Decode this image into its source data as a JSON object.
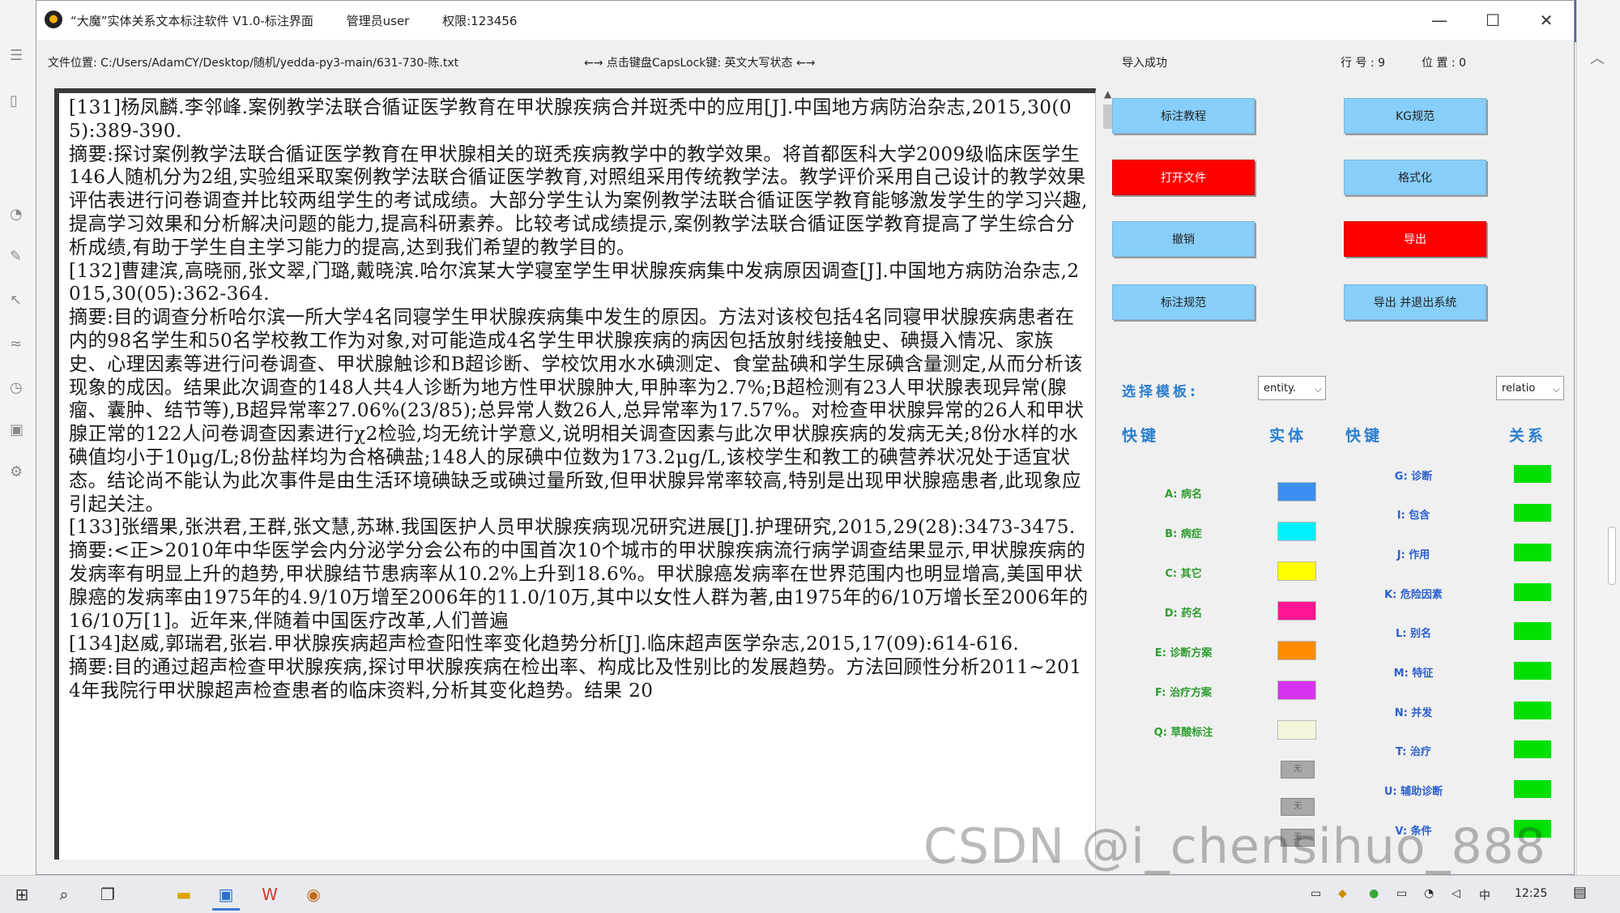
{
  "window": {
    "title": "“大魔”实体关系文本标注软件 V1.0-标注界面",
    "admin": "管理员user",
    "permission": "权限:123456",
    "controls": {
      "minimize": "—",
      "maximize": "☐",
      "close": "✕"
    }
  },
  "infobar": {
    "file_position": "文件位置:  C:/Users/AdamCY/Desktop/随机/yedda-py3-main/631-730-陈.txt",
    "capslock_hint": "←→ 点击键盘CapsLock键:  英文大写状态  ←→",
    "import_status": "导入成功",
    "row": "行 号 : 9",
    "column": "位 置 : 0"
  },
  "editor": {
    "text": "[131]杨凤麟.李邻峰.案例教学法联合循证医学教育在甲状腺疾病合并斑秃中的应用[J].中国地方病防治杂志,2015,30(05):389-390.\n摘要:探讨案例教学法联合循证医学教育在甲状腺相关的斑秃疾病教学中的教学效果。将首都医科大学2009级临床医学生146人随机分为2组,实验组采取案例教学法联合循证医学教育,对照组采用传统教学法。教学评价采用自己设计的教学效果评估表进行问卷调查并比较两组学生的考试成绩。大部分学生认为案例教学法联合循证医学教育能够激发学生的学习兴趣,提高学习效果和分析解决问题的能力,提高科研素养。比较考试成绩提示,案例教学法联合循证医学教育提高了学生综合分析成绩,有助于学生自主学习能力的提高,达到我们希望的教学目的。\n[132]曹建滨,高晓丽,张文翠,门璐,戴晓滨.哈尔滨某大学寝室学生甲状腺疾病集中发病原因调查[J].中国地方病防治杂志,2015,30(05):362-364.\n摘要:目的调查分析哈尔滨一所大学4名同寝学生甲状腺疾病集中发生的原因。方法对该校包括4名同寝甲状腺疾病患者在内的98名学生和50名学校教工作为对象,对可能造成4名学生甲状腺疾病的病因包括放射线接触史、碘摄入情况、家族史、心理因素等进行问卷调查、甲状腺触诊和B超诊断、学校饮用水水碘测定、食堂盐碘和学生尿碘含量测定,从而分析该现象的成因。结果此次调查的148人共4人诊断为地方性甲状腺肿大,甲肿率为2.7%;B超检测有23人甲状腺表现异常(腺瘤、囊肿、结节等),B超异常率27.06%(23/85);总异常人数26人,总异常率为17.57%。对检查甲状腺异常的26人和甲状腺正常的122人问卷调查因素进行χ2检验,均无统计学意义,说明相关调查因素与此次甲状腺疾病的发病无关;8份水样的水碘值均小于10μg/L;8份盐样均为合格碘盐;148人的尿碘中位数为173.2μg/L,该校学生和教工的碘营养状况处于适宜状态。结论尚不能认为此次事件是由生活环境碘缺乏或碘过量所致,但甲状腺异常率较高,特别是出现甲状腺癌患者,此现象应引起关注。\n[133]张缙果,张洪君,王群,张文慧,苏琳.我国医护人员甲状腺疾病现况研究进展[J].护理研究,2015,29(28):3473-3475.\n摘要:<正>2010年中华医学会内分泌学分会公布的中国首次10个城市的甲状腺疾病流行病学调查结果显示,甲状腺疾病的发病率有明显上升的趋势,甲状腺结节患病率从10.2%上升到18.6%。甲状腺癌发病率在世界范围内也明显增高,美国甲状腺癌的发病率由1975年的4.9/10万增至2006年的11.0/10万,其中以女性人群为著,由1975年的6/10万增长至2006年的16/10万[1]。近年来,伴随着中国医疗改革,人们普遍\n[134]赵威,郭瑞君,张岩.甲状腺疾病超声检查阳性率变化趋势分析[J].临床超声医学杂志,2015,17(09):614-616.\n摘要:目的通过超声检查甲状腺疾病,探讨甲状腺疾病在检出率、构成比及性别比的发展趋势。方法回顾性分析2011~2014年我院行甲状腺超声检查患者的临床资料,分析其变化趋势。结果 20"
  },
  "buttons": {
    "tutorial": "标注教程",
    "kg_spec": "KG规范",
    "open_file": "打开文件",
    "format": "格式化",
    "undo": "撤销",
    "export": "导出",
    "annotation_spec": "标注规范",
    "export_exit": "导出 并退出系统"
  },
  "template": {
    "label": "选择模板:",
    "entity_value": "entity.",
    "relation_value": "relatio"
  },
  "headers": {
    "shortcut_left": "快键",
    "entity": "实体",
    "shortcut_right": "快键",
    "relation": "关系"
  },
  "entities": [
    {
      "key": "A: 病名",
      "color": "#3a8ff0"
    },
    {
      "key": "B: 病症",
      "color": "#00f0ff"
    },
    {
      "key": "C: 其它",
      "color": "#ffff00"
    },
    {
      "key": "D: 药名",
      "color": "#ff1493"
    },
    {
      "key": "E: 诊断方案",
      "color": "#ff8c00"
    },
    {
      "key": "F: 治疗方案",
      "color": "#d633f0"
    },
    {
      "key": "Q: 草酸标注",
      "color": "#f5f5dc"
    }
  ],
  "extra_slots": [
    "无",
    "无",
    "无"
  ],
  "relations": [
    {
      "key": "G: 诊断",
      "color": "#00e000"
    },
    {
      "key": "I: 包含",
      "color": "#00e000"
    },
    {
      "key": "J: 作用",
      "color": "#00e000"
    },
    {
      "key": "K: 危险因素",
      "color": "#00e000"
    },
    {
      "key": "L: 别名",
      "color": "#00e000"
    },
    {
      "key": "M: 特征",
      "color": "#00e000"
    },
    {
      "key": "N: 并发",
      "color": "#00e000"
    },
    {
      "key": "T: 治疗",
      "color": "#00e000"
    },
    {
      "key": "U: 辅助诊断",
      "color": "#00e000"
    },
    {
      "key": "V: 条件",
      "color": "#00e000"
    }
  ],
  "watermark": "CSDN @i_chensihuo_888",
  "taskbar": {
    "lang": "中",
    "time": "12:25"
  }
}
